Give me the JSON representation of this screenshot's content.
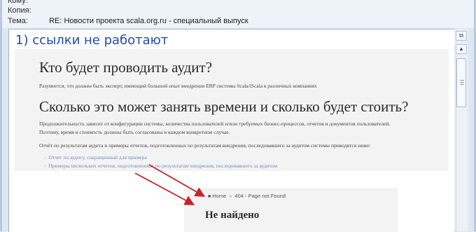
{
  "header": {
    "to_label": "Кому:",
    "to_value": "",
    "cc_label": "Копия:",
    "cc_value": "",
    "subject_label": "Тема:",
    "subject_value": "RE: Новости проекта scala.org.ru - специальный выпуск"
  },
  "annotation": "1) ссылки не работают",
  "pasted_page": {
    "heading1": "Кто будет проводить аудит?",
    "para1": "Разумеется, это должен быть эксперт, имеющий большой опыт внедрения ERP системы Scala/iScala в различных компаниях",
    "heading2": "Сколько это может занять времени и сколько будет стоить?",
    "para2": "Продолжительность зависит от конфигурации системы, количества пользователей и/или требуемых бизнес-процессов, отчетов и документов пользователей.",
    "para3": "Поэтому, время и стоимость должны быть согласованы в каждом конкретном случае.",
    "para4": "Отчёт по результатам аудита и примеры отчетов, подготовленных по результатам внедрения, последовавшего за аудитом системы приводятся ниже:",
    "links": [
      "Отчет по аудиту, сокращенный для примера",
      "Примеры нескольких отчетов, подготовленных по результатам внедрения, последовавшего за аудитом"
    ]
  },
  "pasted_404": {
    "breadcrumb_home": "Home",
    "breadcrumb_current": "404 - Page not Found",
    "title": "Не найдено"
  },
  "colors": {
    "annotation": "#1f4fa0",
    "arrow": "#c8242b",
    "link": "#6a8fc4"
  }
}
